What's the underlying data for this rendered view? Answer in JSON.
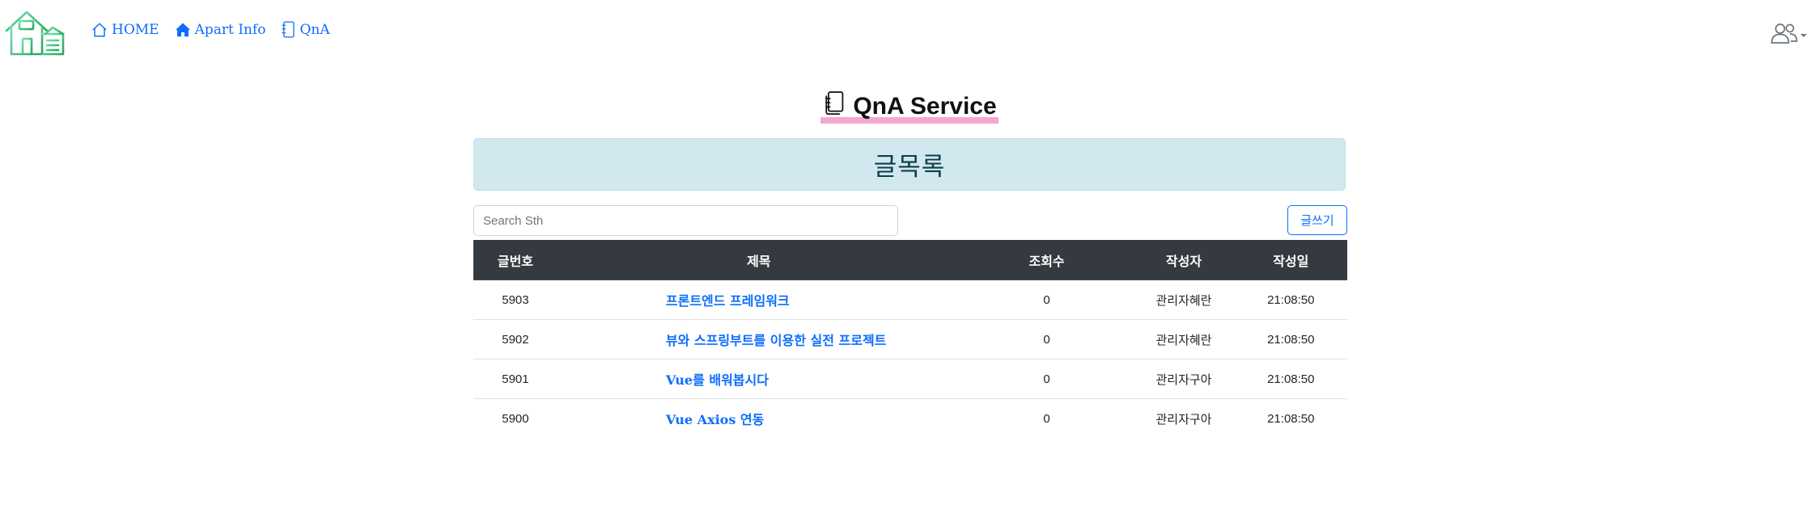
{
  "nav": {
    "links": [
      {
        "label": "HOME",
        "icon": "house-outline-icon"
      },
      {
        "label": "Apart Info",
        "icon": "house-fill-icon"
      },
      {
        "label": "QnA",
        "icon": "journal-icon"
      }
    ],
    "user_icon": "people-icon",
    "logo_icon": "house-logo-icon"
  },
  "page": {
    "title": "QnA Service",
    "title_icon": "journals-icon",
    "banner": "글목록"
  },
  "search": {
    "placeholder": "Search Sth",
    "value": ""
  },
  "write_button": "글쓰기",
  "table": {
    "headers": [
      "글번호",
      "제목",
      "조회수",
      "작성자",
      "작성일"
    ],
    "rows": [
      {
        "no": "5903",
        "title": "프론트엔드 프레임워크",
        "views": "0",
        "author": "관리자혜란",
        "date": "21:08:50"
      },
      {
        "no": "5902",
        "title": "뷰와 스프링부트를 이용한 실전 프로젝트",
        "views": "0",
        "author": "관리자혜란",
        "date": "21:08:50"
      },
      {
        "no": "5901",
        "title": "Vue를 배워봅시다",
        "views": "0",
        "author": "관리자구아",
        "date": "21:08:50"
      },
      {
        "no": "5900",
        "title": "Vue Axios 연동",
        "views": "0",
        "author": "관리자구아",
        "date": "21:08:50"
      }
    ]
  },
  "colors": {
    "link": "#0d6efd",
    "header_bg": "#343a40",
    "banner_bg": "#d1e8ef",
    "title_highlight": "#f3a8cf",
    "logo_green": "#2fbf71"
  }
}
